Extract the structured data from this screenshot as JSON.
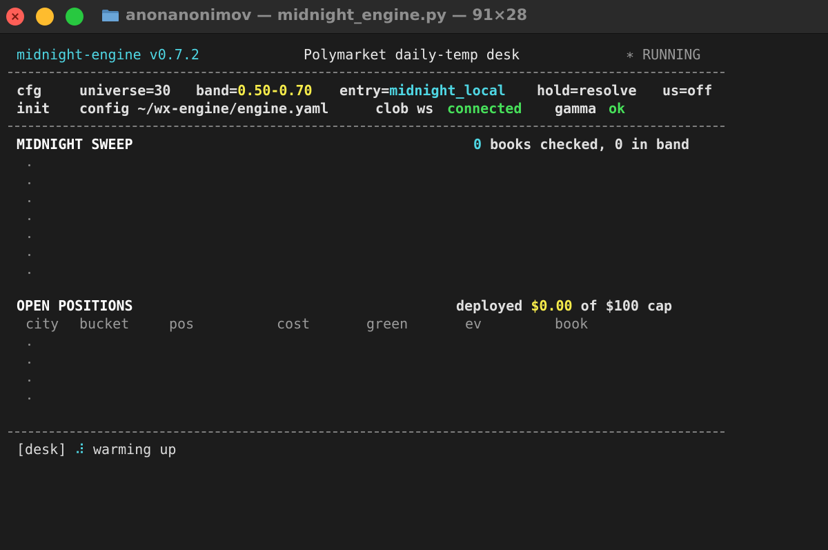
{
  "window": {
    "title": "anonanonimov — midnight_engine.py — 91×28",
    "folder_icon": "folder-icon"
  },
  "header": {
    "app": "midnight-engine v0.7.2",
    "desk": "Polymarket daily-temp desk",
    "status": "∗ RUNNING"
  },
  "config": {
    "cfg_label": "cfg",
    "universe": "universe=30",
    "band_key": "band=",
    "band_value": "0.50-0.70",
    "entry_key": "entry=",
    "entry_value": "midnight_local",
    "hold": "hold=resolve",
    "us": "us=off"
  },
  "init": {
    "label": "init",
    "config_path": "config ~/wx-engine/engine.yaml",
    "clob_label": "clob ws",
    "clob_status": "connected",
    "gamma_label": "gamma",
    "gamma_status": "ok"
  },
  "sweep": {
    "heading": "MIDNIGHT SWEEP",
    "books_checked": "0",
    "summary_rest": " books checked, 0 in band"
  },
  "positions": {
    "heading": "OPEN POSITIONS",
    "deployed_label": "deployed ",
    "deployed_value": "$0.00",
    "cap_text": " of $100 cap",
    "columns": [
      "city",
      "bucket",
      "pos",
      "cost",
      "green",
      "ev",
      "book"
    ]
  },
  "footer": {
    "prompt": "[desk]",
    "spinner": "⠼",
    "message": "warming up"
  }
}
